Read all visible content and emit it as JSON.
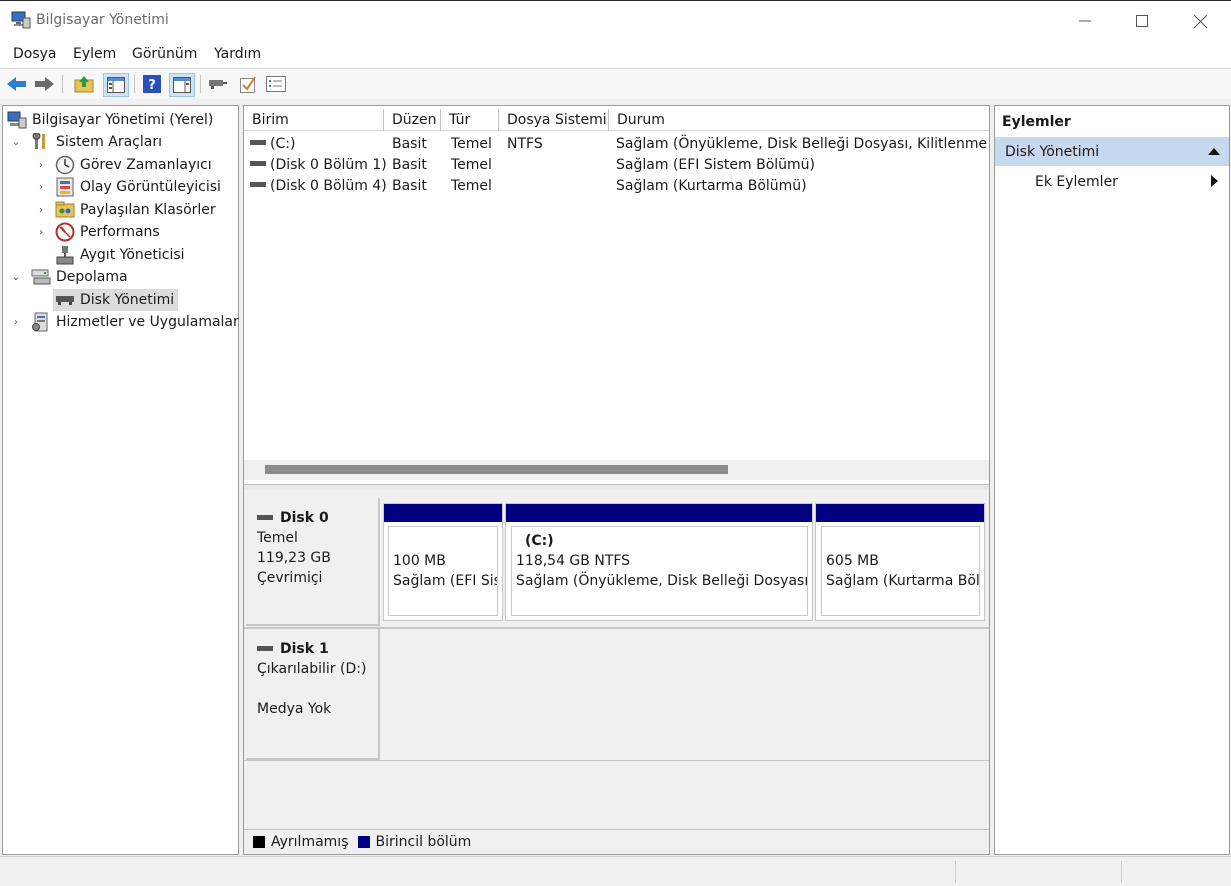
{
  "window": {
    "title": "Bilgisayar Yönetimi"
  },
  "menu": [
    "Dosya",
    "Eylem",
    "Görünüm",
    "Yardım"
  ],
  "toolbar": {
    "icons": [
      "back-icon",
      "forward-icon",
      "up-folder-icon",
      "show-hide-tree-icon",
      "help-icon",
      "show-hide-action-pane-icon",
      "connect-icon",
      "check-icon",
      "properties-icon"
    ]
  },
  "tree": {
    "root": "Bilgisayar Yönetimi (Yerel)",
    "items": [
      {
        "label": "Sistem Araçları",
        "level": 1,
        "expand": "open"
      },
      {
        "label": "Görev Zamanlayıcı",
        "level": 2,
        "expand": "closed"
      },
      {
        "label": "Olay Görüntüleyicisi",
        "level": 2,
        "expand": "closed"
      },
      {
        "label": "Paylaşılan Klasörler",
        "level": 2,
        "expand": "closed"
      },
      {
        "label": "Performans",
        "level": 2,
        "expand": "closed"
      },
      {
        "label": "Aygıt Yöneticisi",
        "level": 2,
        "expand": "none"
      },
      {
        "label": "Depolama",
        "level": 1,
        "expand": "open"
      },
      {
        "label": "Disk Yönetimi",
        "level": 2,
        "expand": "none",
        "selected": true
      },
      {
        "label": "Hizmetler ve Uygulamalar",
        "level": 1,
        "expand": "closed"
      }
    ]
  },
  "volumes": {
    "columns": [
      "Birim",
      "Düzen",
      "Tür",
      "Dosya Sistemi",
      "Durum"
    ],
    "rows": [
      [
        "(C:)",
        "Basit",
        "Temel",
        "NTFS",
        "Sağlam (Önyükleme, Disk Belleği Dosyası, Kilitlenme Bilg"
      ],
      [
        "(Disk 0 Bölüm 1)",
        "Basit",
        "Temel",
        "",
        "Sağlam (EFI Sistem Bölümü)"
      ],
      [
        "(Disk 0 Bölüm 4)",
        "Basit",
        "Temel",
        "",
        "Sağlam (Kurtarma Bölümü)"
      ]
    ]
  },
  "disks": {
    "disk0": {
      "name": "Disk 0",
      "type": "Temel",
      "size": "119,23 GB",
      "state": "Çevrimiçi",
      "partitions": [
        {
          "label": "",
          "size": "100 MB",
          "status": "Sağlam (EFI Sistem Bölümü)"
        },
        {
          "label": "(C:)",
          "size": "118,54 GB NTFS",
          "status": "Sağlam (Önyükleme, Disk Belleği Dosyası, Kilitlenme Bilgi"
        },
        {
          "label": "",
          "size": "605 MB",
          "status": "Sağlam (Kurtarma Bölümü)"
        }
      ]
    },
    "disk1": {
      "name": "Disk 1",
      "type": "Çıkarılabilir (D:)",
      "media": "Medya Yok"
    }
  },
  "legend": [
    {
      "label": "Ayrılmamış",
      "color": "#000000"
    },
    {
      "label": "Birincil bölüm",
      "color": "#000080"
    }
  ],
  "actions": {
    "title": "Eylemler",
    "section": "Disk Yönetimi",
    "more": "Ek Eylemler"
  }
}
